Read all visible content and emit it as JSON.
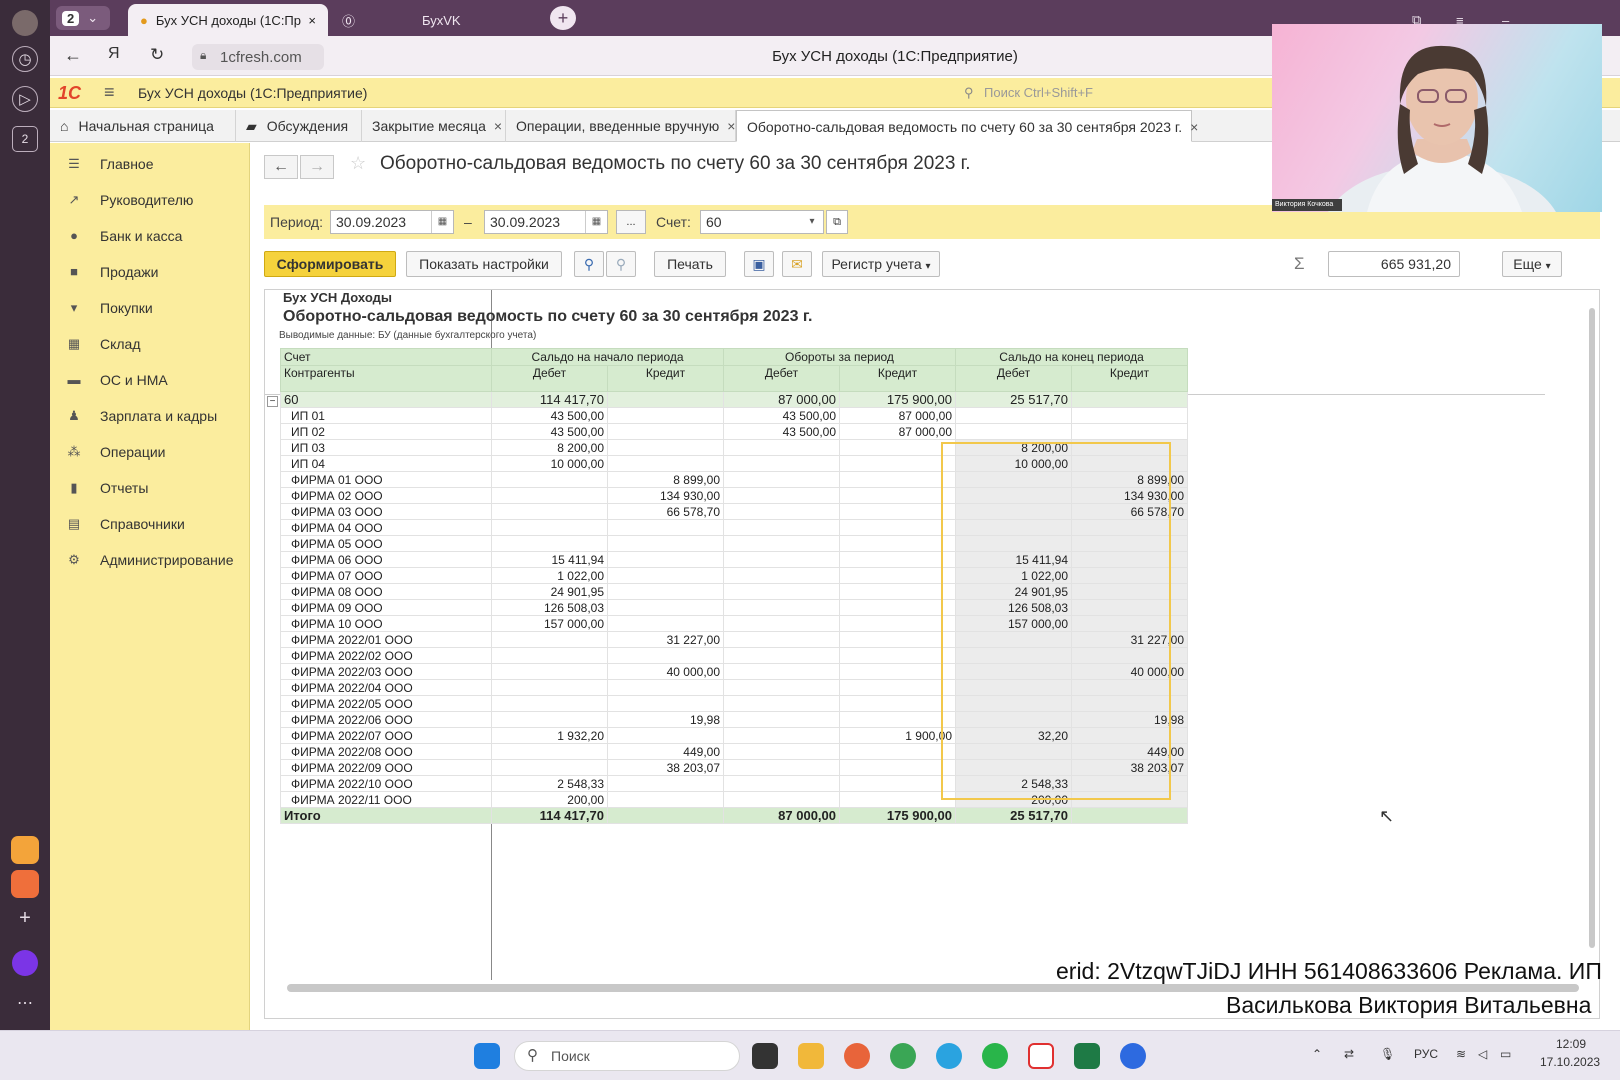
{
  "browser": {
    "tab_count": "2",
    "active_tab_title": "Бух УСН доходы (1С:Пр",
    "second_tab_title": "БухVK",
    "url": "1cfresh.com",
    "page_title": "Бух УСН доходы (1С:Предприятие)"
  },
  "app": {
    "logo": "1С",
    "name": "Бух УСН доходы  (1С:Предприятие)",
    "search_placeholder": "Поиск Ctrl+Shift+F"
  },
  "tabs": [
    {
      "label": "Начальная страница"
    },
    {
      "label": "Обсуждения"
    },
    {
      "label": "Закрытие месяца"
    },
    {
      "label": "Операции, введенные вручную"
    },
    {
      "label": "Оборотно-сальдовая ведомость по счету 60 за 30 сентября 2023 г."
    }
  ],
  "sidebar": {
    "items": [
      {
        "label": "Главное",
        "icon": "menu-icon"
      },
      {
        "label": "Руководителю",
        "icon": "trend-icon"
      },
      {
        "label": "Банк и касса",
        "icon": "coins-icon"
      },
      {
        "label": "Продажи",
        "icon": "bag-icon"
      },
      {
        "label": "Покупки",
        "icon": "cart-icon"
      },
      {
        "label": "Склад",
        "icon": "warehouse-icon"
      },
      {
        "label": "ОС и НМА",
        "icon": "truck-icon"
      },
      {
        "label": "Зарплата и кадры",
        "icon": "person-icon"
      },
      {
        "label": "Операции",
        "icon": "operations-icon"
      },
      {
        "label": "Отчеты",
        "icon": "chart-icon"
      },
      {
        "label": "Справочники",
        "icon": "book-icon"
      },
      {
        "label": "Администрирование",
        "icon": "gear-icon"
      }
    ]
  },
  "form": {
    "title": "Оборотно-сальдовая ведомость по счету 60 за 30 сентября 2023 г.",
    "period_label": "Период:",
    "date_from": "30.09.2023",
    "date_dash": "–",
    "date_to": "30.09.2023",
    "dots_label": "...",
    "account_label": "Счет:",
    "account_value": "60"
  },
  "toolbar": {
    "generate": "Сформировать",
    "show_settings": "Показать настройки",
    "print": "Печать",
    "register": "Регистр учета",
    "sum_value": "665 931,20",
    "more": "Еще"
  },
  "report": {
    "org": "Бух УСН Доходы",
    "title": "Оборотно-сальдовая ведомость по счету 60 за 30 сентября 2023 г.",
    "subtitle": "Выводимые данные:  БУ (данные бухгалтерского учета)",
    "headers": {
      "account": "Счет",
      "counterparties": "Контрагенты",
      "opening": "Сальдо на начало периода",
      "turnover": "Обороты за период",
      "closing": "Сальдо на конец периода",
      "debit": "Дебет",
      "credit": "Кредит"
    },
    "account_row": [
      "60",
      "114 417,70",
      "",
      "87 000,00",
      "175 900,00",
      "25 517,70",
      ""
    ],
    "rows": [
      [
        "ИП 01",
        "43 500,00",
        "",
        "43 500,00",
        "87 000,00",
        "",
        ""
      ],
      [
        "ИП 02",
        "43 500,00",
        "",
        "43 500,00",
        "87 000,00",
        "",
        ""
      ],
      [
        "ИП 03",
        "8 200,00",
        "",
        "",
        "",
        "8 200,00",
        ""
      ],
      [
        "ИП 04",
        "10 000,00",
        "",
        "",
        "",
        "10 000,00",
        ""
      ],
      [
        "ФИРМА 01 ООО",
        "",
        "8 899,00",
        "",
        "",
        "",
        "8 899,00"
      ],
      [
        "ФИРМА 02 ООО",
        "",
        "134 930,00",
        "",
        "",
        "",
        "134 930,00"
      ],
      [
        "ФИРМА 03 ООО",
        "",
        "66 578,70",
        "",
        "",
        "",
        "66 578,70"
      ],
      [
        "ФИРМА 04 ООО",
        "",
        "",
        "",
        "",
        "",
        ""
      ],
      [
        "ФИРМА 05 ООО",
        "",
        "",
        "",
        "",
        "",
        ""
      ],
      [
        "ФИРМА 06 ООО",
        "15 411,94",
        "",
        "",
        "",
        "15 411,94",
        ""
      ],
      [
        "ФИРМА 07 ООО",
        "1 022,00",
        "",
        "",
        "",
        "1 022,00",
        ""
      ],
      [
        "ФИРМА 08 ООО",
        "24 901,95",
        "",
        "",
        "",
        "24 901,95",
        ""
      ],
      [
        "ФИРМА 09 ООО",
        "126 508,03",
        "",
        "",
        "",
        "126 508,03",
        ""
      ],
      [
        "ФИРМА 10 ООО",
        "157 000,00",
        "",
        "",
        "",
        "157 000,00",
        ""
      ],
      [
        "ФИРМА 2022/01 ООО",
        "",
        "31 227,00",
        "",
        "",
        "",
        "31 227,00"
      ],
      [
        "ФИРМА 2022/02 ООО",
        "",
        "",
        "",
        "",
        "",
        ""
      ],
      [
        "ФИРМА 2022/03 ООО",
        "",
        "40 000,00",
        "",
        "",
        "",
        "40 000,00"
      ],
      [
        "ФИРМА 2022/04 ООО",
        "",
        "",
        "",
        "",
        "",
        ""
      ],
      [
        "ФИРМА 2022/05 ООО",
        "",
        "",
        "",
        "",
        "",
        ""
      ],
      [
        "ФИРМА 2022/06 ООО",
        "",
        "19,98",
        "",
        "",
        "",
        "19,98"
      ],
      [
        "ФИРМА 2022/07 ООО",
        "1 932,20",
        "",
        "",
        "1 900,00",
        "32,20",
        ""
      ],
      [
        "ФИРМА 2022/08 ООО",
        "",
        "449,00",
        "",
        "",
        "",
        "449,00"
      ],
      [
        "ФИРМА 2022/09 ООО",
        "",
        "38 203,07",
        "",
        "",
        "",
        "38 203,07"
      ],
      [
        "ФИРМА 2022/10 ООО",
        "2 548,33",
        "",
        "",
        "",
        "2 548,33",
        ""
      ],
      [
        "ФИРМА 2022/11 ООО",
        "200,00",
        "",
        "",
        "",
        "200,00",
        ""
      ]
    ],
    "total_row": [
      "Итого",
      "114 417,70",
      "",
      "87 000,00",
      "175 900,00",
      "25 517,70",
      ""
    ]
  },
  "webcam": {
    "name_tag": "Виктория Кочкова"
  },
  "ad": {
    "line1": "erid: 2VtzqwTJiDJ ИНН 561408633606 Реклама. ИП",
    "line2": "Василькова Виктория Витальевна"
  },
  "taskbar": {
    "search_label": "Поиск",
    "lang": "РУС",
    "time": "12:09",
    "date": "17.10.2023"
  },
  "colors": {
    "accent_yellow": "#fbed9e",
    "primary_button": "#f5d23c",
    "table_header_green": "#d6ebcf",
    "highlight_border": "#f2c84b",
    "browser_tabbar": "#5b3d5c"
  }
}
